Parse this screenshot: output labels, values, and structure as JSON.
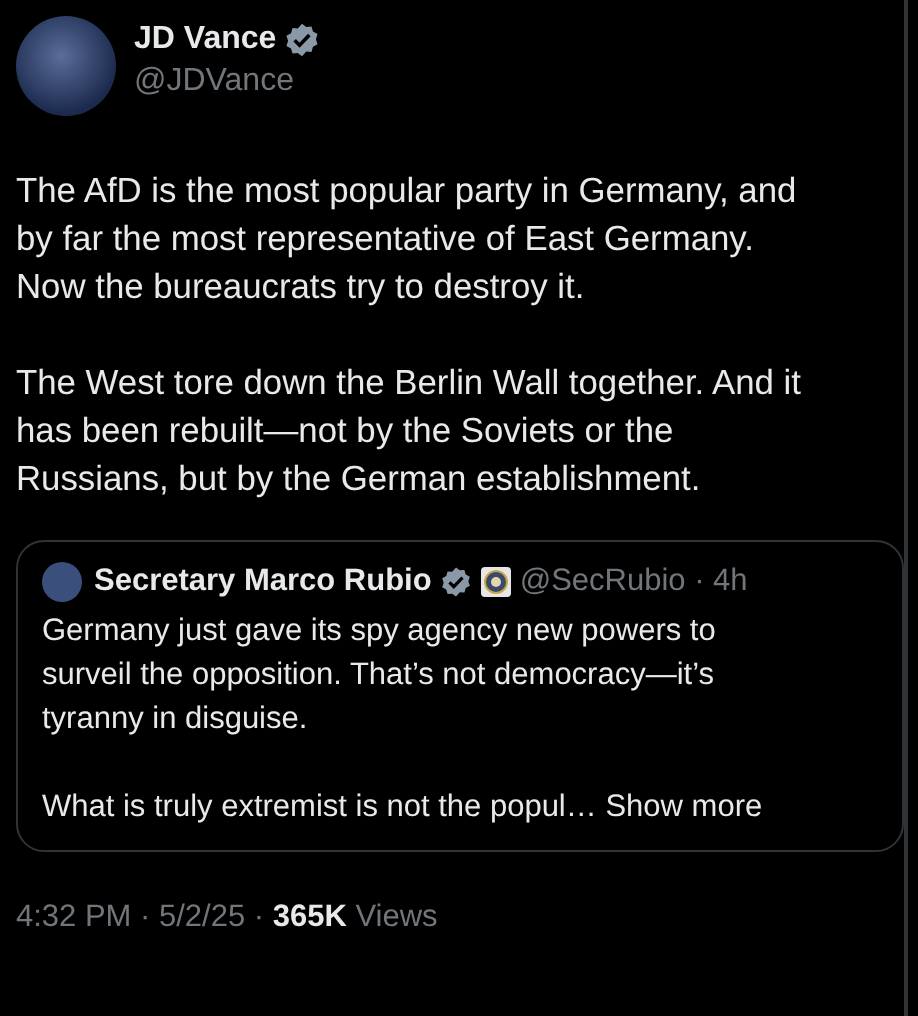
{
  "author": {
    "name": "JD Vance",
    "handle": "@JDVance",
    "verified": true
  },
  "paragraphs": [
    "The AfD is the most popular party in Germany, and\nby far the most representative of East Germany.\nNow the bureaucrats try to destroy it.",
    "The West tore down the Berlin Wall together. And it\nhas been rebuilt—not by the Soviets or the\nRussians, but by the German establishment."
  ],
  "quote": {
    "name": "Secretary Marco Rubio",
    "verified": true,
    "affiliate_badge": true,
    "handle_time": "@SecRubio · 4h",
    "paragraphs": [
      "Germany just gave its spy agency new powers to\nsurveil the opposition.  That’s not democracy—it’s\ntyranny in disguise.",
      "What is truly extremist is not the popul…"
    ],
    "show_more": "Show more"
  },
  "meta": "4:32 PM · 5/2/25 · **365K** Views"
}
